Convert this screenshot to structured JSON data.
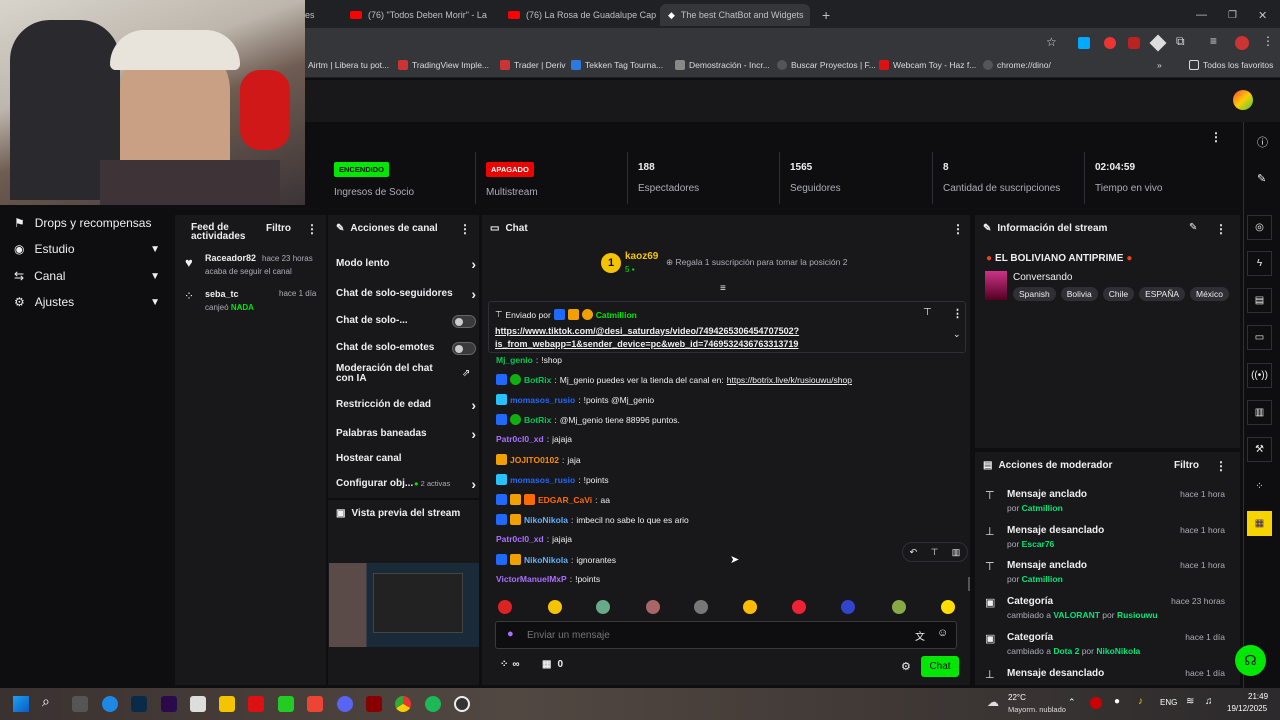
{
  "browser": {
    "tabs": [
      {
        "title": "(76) \"Todos Deben Morir\" - La "
      },
      {
        "title": "(76) La Rosa de Guadalupe Cap"
      },
      {
        "title": "The best ChatBot and Widgets"
      }
    ],
    "partial_tab": "es",
    "new_tab": "+",
    "bookmarks": [
      "Airtm | Libera tu pot...",
      "TradingView Imple...",
      "Trader | Deriv",
      "Tekken Tag Tourna...",
      "Demostración - Incr...",
      "Buscar Proyectos | F...",
      "Webcam Toy - Haz f...",
      "chrome://dino/"
    ],
    "all_bookmarks": "Todos los favoritos"
  },
  "stats": {
    "partner": {
      "pill": "ENCENDIDO",
      "label": "Ingresos de Socio"
    },
    "multistream": {
      "pill": "APAGADO",
      "label": "Multistream"
    },
    "viewers": {
      "value": "188",
      "label": "Espectadores"
    },
    "followers": {
      "value": "1565",
      "label": "Seguidores"
    },
    "subs": {
      "value": "8",
      "label": "Cantidad de suscripciones"
    },
    "uptime": {
      "value": "02:04:59",
      "label": "Tiempo en vivo"
    }
  },
  "leftnav": {
    "items": [
      {
        "label": "Drops y recompensas"
      },
      {
        "label": "Estudio"
      },
      {
        "label": "Canal"
      },
      {
        "label": "Ajustes"
      }
    ]
  },
  "feed": {
    "title": "Feed de actividades",
    "filter": "Filtro",
    "items": [
      {
        "user": "Raceador82",
        "time": "hace 23 horas",
        "text": "acaba de seguir el canal"
      },
      {
        "user": "seba_tc",
        "time": "hace 1 día",
        "text": "canjeó",
        "highlight": "NADA"
      }
    ]
  },
  "actions": {
    "title": "Acciones de canal",
    "items": [
      "Modo lento",
      "Chat de solo-seguidores",
      "Chat de solo-...",
      "Chat de solo-emotes",
      "Moderación del chat con IA",
      "Restricción de edad",
      "Palabras baneadas",
      "Hostear canal",
      "Configurar obj..."
    ],
    "active_count": "2 activas",
    "preview": "Vista previa del stream"
  },
  "chat": {
    "title": "Chat",
    "top_user": "kaoz69",
    "top_rank": "1",
    "top_count": "5",
    "gift_prompt": "Regala 1 suscripción para tomar la posición 2",
    "pinned_by_label": "Enviado por",
    "pinned_by": "Catmillion",
    "pinned_link": "https://www.tiktok.com/@desi_saturdays/video/7494265306454707502?is_from_webapp=1&sender_device=pc&web_id=7469532436763313719",
    "pinned_link_line1": "https://www.tiktok.com/@desi_saturdays/video/7494265306454707502?",
    "pinned_link_line2": "is_from_webapp=1&sender_device=pc&web_id=7469532436763313719",
    "messages": [
      {
        "user": "Mj_genio",
        "color": "#00c853",
        "text": "!shop"
      },
      {
        "user": "BotRix",
        "color": "#00c853",
        "text": "Mj_genio puedes ver la tienda del canal en: ",
        "link": "https://botrix.live/k/rusiouwu/shop"
      },
      {
        "user": "momasos_rusio",
        "color": "#1f69ff",
        "text": "!points @Mj_genio"
      },
      {
        "user": "BotRix",
        "color": "#00c853",
        "text": "@Mj_genio tiene 88996 puntos."
      },
      {
        "user": "Patr0cl0_xd",
        "color": "#a970ff",
        "text": "jajaja"
      },
      {
        "user": "JOJITO0102",
        "color": "#ff8c00",
        "text": "jaja"
      },
      {
        "user": "momasos_rusio",
        "color": "#1f69ff",
        "text": "!points"
      },
      {
        "user": "EDGAR_CaVi",
        "color": "#ff6a00",
        "text": "aa"
      },
      {
        "user": "NikoNikola",
        "color": "#5fb3ff",
        "text": "imbecil no sabe lo que es ario"
      },
      {
        "user": "Patr0cl0_xd",
        "color": "#a970ff",
        "text": "jajaja"
      },
      {
        "user": "NikoNikola",
        "color": "#5fb3ff",
        "text": "ignorantes"
      },
      {
        "user": "VictorManuelMxP",
        "color": "#a970ff",
        "text": "!points"
      }
    ],
    "input_placeholder": "Enviar un mensaje",
    "points": "∞",
    "drops": "0",
    "send": "Chat"
  },
  "stream_info": {
    "title": "Información del stream",
    "stream_title": "EL BOLIVIANO ANTIPRIME",
    "category": "Conversando",
    "tags": [
      "Spanish",
      "Bolivia",
      "Chile",
      "ESPAÑA",
      "México"
    ]
  },
  "mod_actions": {
    "title": "Acciones de moderador",
    "filter": "Filtro",
    "items": [
      {
        "title": "Mensaje anclado",
        "by_label": "por",
        "by": "Catmillion",
        "time": "hace 1 hora",
        "icon": "pin-icon"
      },
      {
        "title": "Mensaje desanclado",
        "by_label": "por",
        "by": "Escar76",
        "time": "hace 1 hora",
        "icon": "unpin-icon"
      },
      {
        "title": "Mensaje anclado",
        "by_label": "por",
        "by": "Catmillion",
        "time": "hace 1 hora",
        "icon": "pin-icon"
      },
      {
        "title": "Categoría",
        "by_label": "cambiado a",
        "value": "VALORANT",
        "by_label2": "por",
        "by": "Rusiouwu",
        "time": "hace 23 horas",
        "icon": "category-icon"
      },
      {
        "title": "Categoría",
        "by_label": "cambiado a",
        "value": "Dota 2",
        "by_label2": "por",
        "by": "NikoNikola",
        "time": "hace 1 día",
        "icon": "category-icon"
      },
      {
        "title": "Mensaje desanclado",
        "time": "hace 1 día",
        "icon": "unpin-icon"
      }
    ]
  },
  "taskbar": {
    "weather_temp": "22°C",
    "weather_text": "Mayorm. nublado",
    "lang": "ENG",
    "time": "21:49",
    "date": "19/12/2025"
  },
  "colors": {
    "accent": "#00e701",
    "offline": "#eb0400",
    "bg": "#0e0e10",
    "panel": "#18181b"
  }
}
